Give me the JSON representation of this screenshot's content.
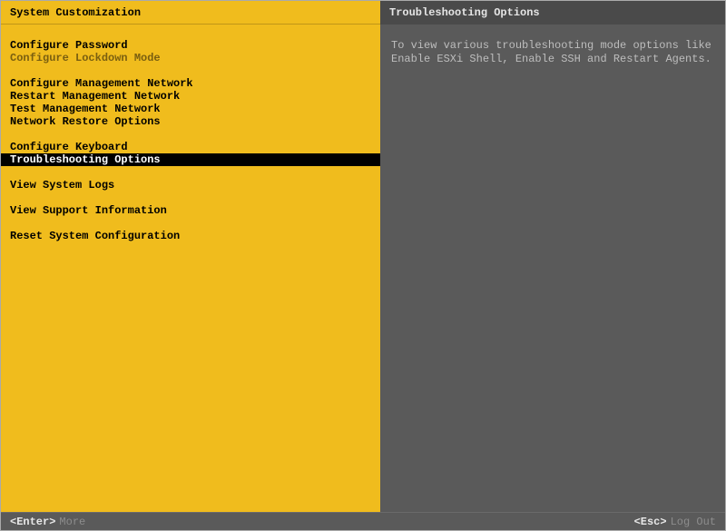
{
  "left": {
    "title": "System Customization",
    "groups": [
      [
        {
          "label": "Configure Password",
          "dim": false,
          "selected": false
        },
        {
          "label": "Configure Lockdown Mode",
          "dim": true,
          "selected": false
        }
      ],
      [
        {
          "label": "Configure Management Network",
          "dim": false,
          "selected": false
        },
        {
          "label": "Restart Management Network",
          "dim": false,
          "selected": false
        },
        {
          "label": "Test Management Network",
          "dim": false,
          "selected": false
        },
        {
          "label": "Network Restore Options",
          "dim": false,
          "selected": false
        }
      ],
      [
        {
          "label": "Configure Keyboard",
          "dim": false,
          "selected": false
        },
        {
          "label": "Troubleshooting Options",
          "dim": false,
          "selected": true
        }
      ],
      [
        {
          "label": "View System Logs",
          "dim": false,
          "selected": false
        }
      ],
      [
        {
          "label": "View Support Information",
          "dim": false,
          "selected": false
        }
      ],
      [
        {
          "label": "Reset System Configuration",
          "dim": false,
          "selected": false
        }
      ]
    ]
  },
  "right": {
    "title": "Troubleshooting Options",
    "body": "To view various troubleshooting mode options like Enable ESXi Shell, Enable SSH and Restart Agents."
  },
  "footer": {
    "enter_key": "<Enter>",
    "enter_label": "More",
    "esc_key": "<Esc>",
    "esc_label": "Log Out"
  }
}
